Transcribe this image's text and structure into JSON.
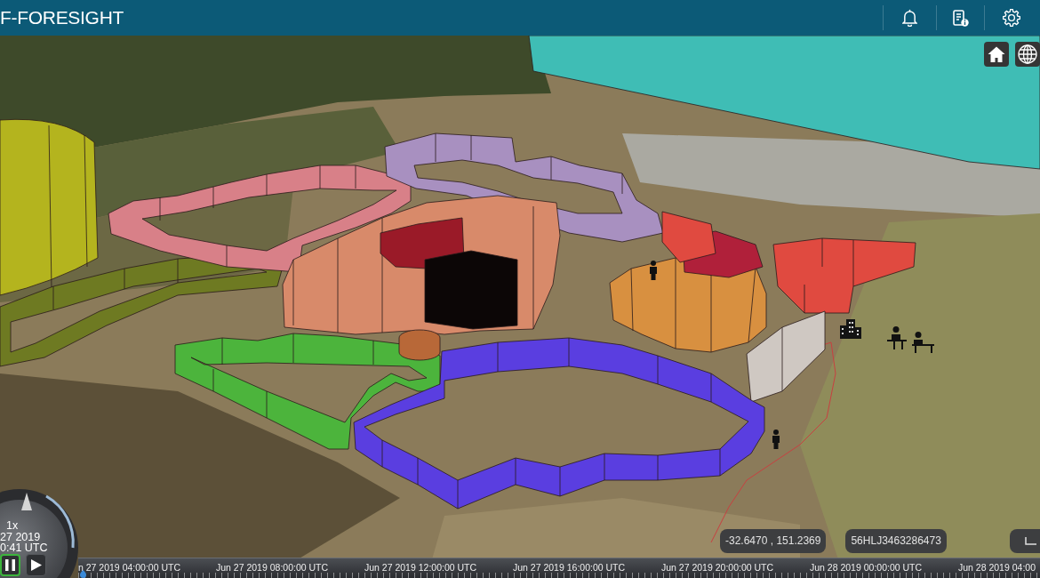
{
  "app_bar": {
    "title": "F-FORESIGHT"
  },
  "map": {
    "zones": [
      {
        "color": "#3fbdb5"
      },
      {
        "color": "#b4b41e"
      },
      {
        "color": "#6e7a22"
      },
      {
        "color": "#d88088"
      },
      {
        "color": "#a890c0"
      },
      {
        "color": "#d88a6a"
      },
      {
        "color": "#9a1a28"
      },
      {
        "color": "#0c0606"
      },
      {
        "color": "#d89040"
      },
      {
        "color": "#b0203a"
      },
      {
        "color": "#e04a40"
      },
      {
        "color": "#cfc8c2"
      },
      {
        "color": "#4cb43c"
      },
      {
        "color": "#5a3ee0"
      },
      {
        "color": "#b86838"
      }
    ]
  },
  "clock": {
    "speed": "1x",
    "date": "27 2019",
    "time": "0:41 UTC",
    "controls": [
      {
        "kind": "pause",
        "selected": true
      },
      {
        "kind": "play",
        "selected": false
      }
    ]
  },
  "coordinates": "-32.6470 , 151.2369",
  "grid_reference": "56HLJ3463286473",
  "timeline": {
    "labels": [
      "n 27 2019 04:00:00 UTC",
      "Jun 27 2019 08:00:00 UTC",
      "Jun 27 2019 12:00:00 UTC",
      "Jun 27 2019 16:00:00 UTC",
      "Jun 27 2019 20:00:00 UTC",
      "Jun 28 2019 00:00:00 UTC",
      "Jun 28 2019 04:00"
    ]
  }
}
